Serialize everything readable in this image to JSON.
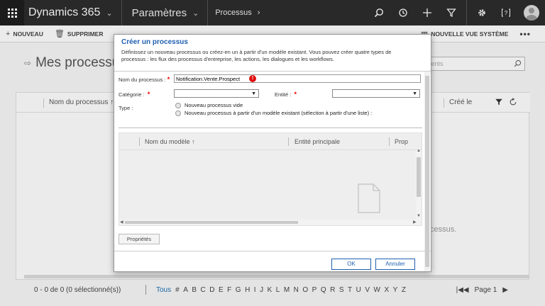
{
  "nav": {
    "app_name": "Dynamics 365",
    "area": "Paramètres",
    "breadcrumb": "Processus"
  },
  "commands": {
    "new": "NOUVEAU",
    "delete": "SUPPRIMER",
    "new_system_view": "NOUVELLE VUE SYSTÈME"
  },
  "page": {
    "title": "Mes processus",
    "search_placeholder": "ements",
    "columns": [
      "Nom du processus",
      "Créé le"
    ],
    "empty_message": "cessus.",
    "footer": {
      "count": "0 - 0  de 0 (0 sélectionné(s))",
      "tous": "Tous",
      "letters": [
        "#",
        "A",
        "B",
        "C",
        "D",
        "E",
        "F",
        "G",
        "H",
        "I",
        "J",
        "K",
        "L",
        "M",
        "N",
        "O",
        "P",
        "Q",
        "R",
        "S",
        "T",
        "U",
        "V",
        "W",
        "X",
        "Y",
        "Z"
      ],
      "page": "Page 1"
    }
  },
  "dialog": {
    "title": "Créer un processus",
    "description": "Définissez un nouveau processus ou créez-en un à partir d'un modèle existant. Vous pouvez créer quatre types de processus : les flux des processus d'entreprise, les actions, les dialogues et les workflows.",
    "name_label": "Nom du processus :",
    "name_value": "Notification.Vente.Prospect",
    "error_glyph": "!",
    "category_label": "Catégorie :",
    "category_value": "",
    "entity_label": "Entité :",
    "entity_value": "",
    "type_label": "Type :",
    "type_options": [
      "Nouveau processus vide",
      "Nouveau processus à partir d'un modèle existant (sélection à partir d'une liste) :"
    ],
    "template_columns": [
      "Nom du modèle",
      "Entité principale",
      "Prop"
    ],
    "properties_button": "Propriétés",
    "ok_button": "OK",
    "cancel_button": "Annuler"
  },
  "colors": {
    "nav_bg": "#2d2d2d",
    "accent": "#1f5fb0",
    "required": "#e00000"
  }
}
